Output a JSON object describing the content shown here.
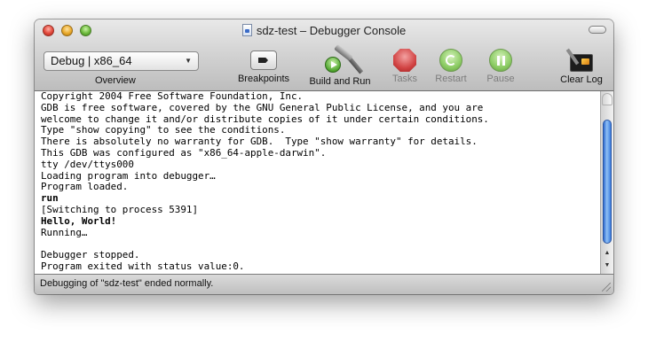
{
  "window": {
    "title": "sdz-test – Debugger Console"
  },
  "toolbar": {
    "scheme_value": "Debug | x86_64",
    "overview_label": "Overview",
    "breakpoints_label": "Breakpoints",
    "build_run_label": "Build and Run",
    "tasks_label": "Tasks",
    "restart_label": "Restart",
    "pause_label": "Pause",
    "clear_log_label": "Clear Log"
  },
  "console": {
    "lines": [
      {
        "text": "Copyright 2004 Free Software Foundation, Inc.",
        "bold": false
      },
      {
        "text": "GDB is free software, covered by the GNU General Public License, and you are",
        "bold": false
      },
      {
        "text": "welcome to change it and/or distribute copies of it under certain conditions.",
        "bold": false
      },
      {
        "text": "Type \"show copying\" to see the conditions.",
        "bold": false
      },
      {
        "text": "There is absolutely no warranty for GDB.  Type \"show warranty\" for details.",
        "bold": false
      },
      {
        "text": "This GDB was configured as \"x86_64-apple-darwin\".",
        "bold": false
      },
      {
        "text": "tty /dev/ttys000",
        "bold": false
      },
      {
        "text": "Loading program into debugger…",
        "bold": false
      },
      {
        "text": "Program loaded.",
        "bold": false
      },
      {
        "text": "run",
        "bold": true
      },
      {
        "text": "[Switching to process 5391]",
        "bold": false
      },
      {
        "text": "Hello, World!",
        "bold": true
      },
      {
        "text": "Running…",
        "bold": false
      },
      {
        "text": "",
        "bold": false
      },
      {
        "text": "Debugger stopped.",
        "bold": false
      },
      {
        "text": "Program exited with status value:0.",
        "bold": false
      }
    ]
  },
  "status": {
    "text": "Debugging of \"sdz-test\" ended normally."
  },
  "icons": {
    "close": "close-button-icon",
    "minimize": "minimize-button-icon",
    "zoom": "zoom-button-icon",
    "document": "document-icon",
    "breakpoints": "breakpoints-icon",
    "build_run": "hammer-play-icon",
    "tasks": "stop-sign-icon",
    "restart": "restart-icon",
    "pause": "pause-icon",
    "clear_log": "clear-console-icon"
  },
  "colors": {
    "close": "#e2473a",
    "minimize": "#e9a92a",
    "zoom": "#6cba3c",
    "scroll_thumb": "#3e7fe0",
    "disabled_label": "#7d7d7d"
  }
}
